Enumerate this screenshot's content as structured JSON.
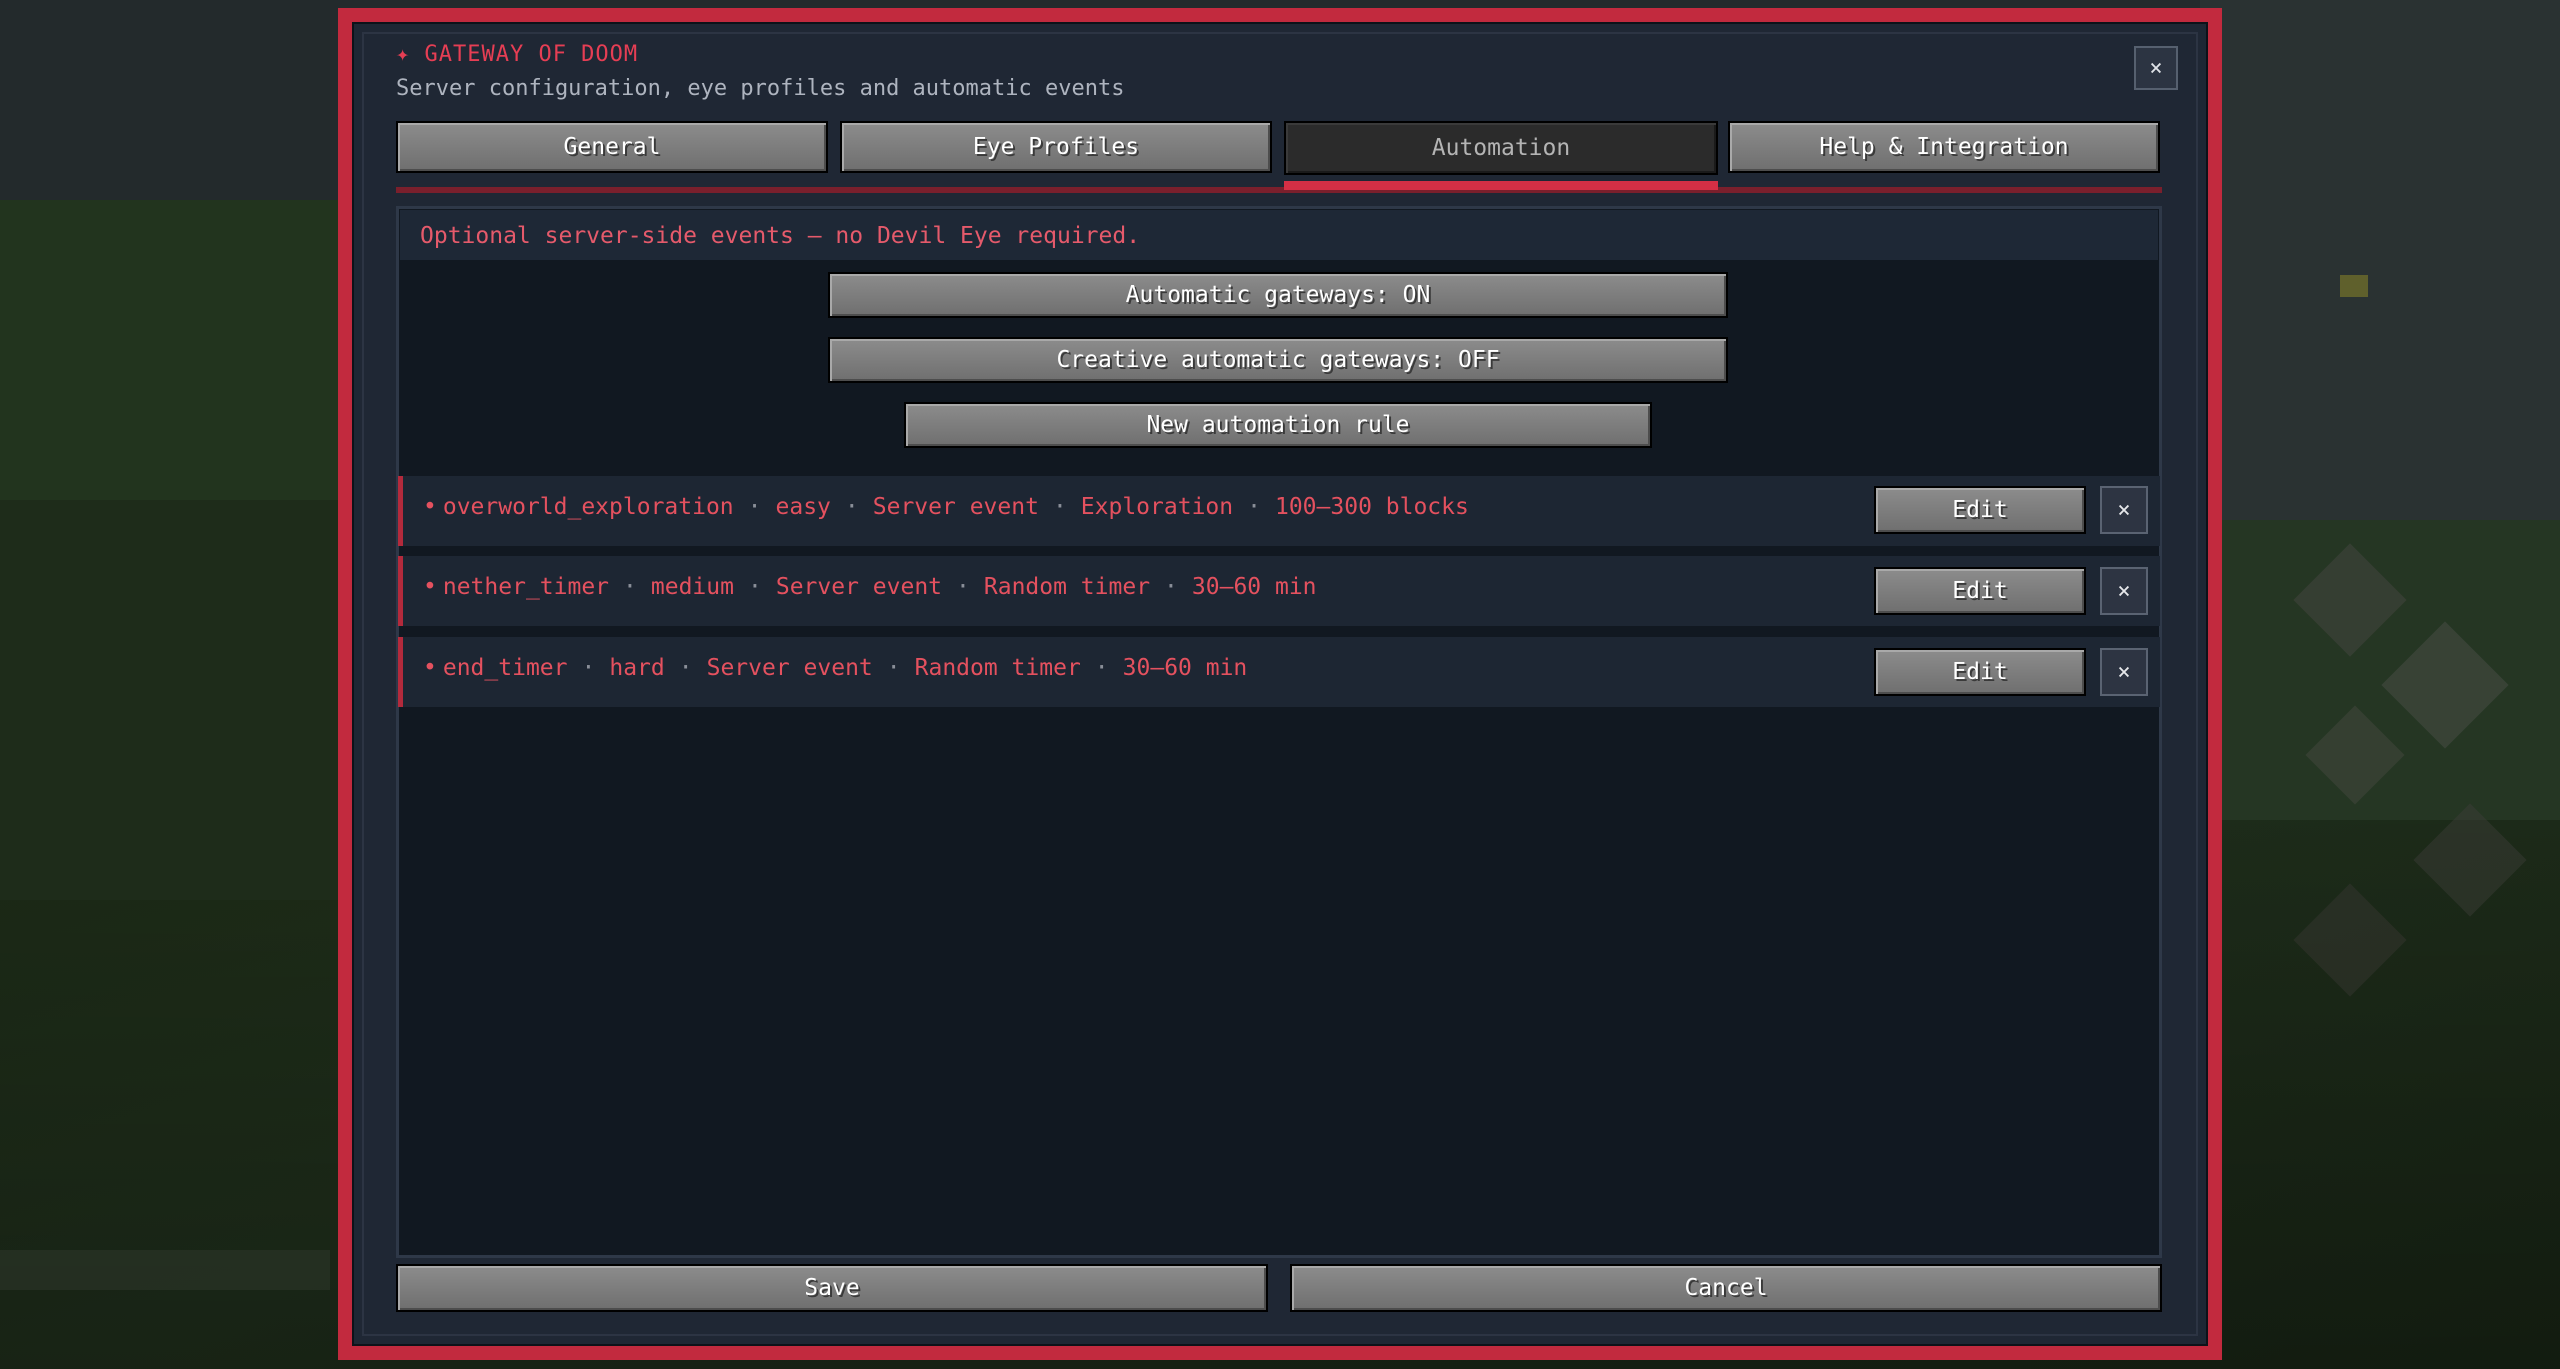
{
  "dialog": {
    "title": "✦ GATEWAY OF DOOM",
    "subtitle": "Server configuration, eye profiles and automatic events",
    "close_label": "×"
  },
  "tabs": [
    {
      "label": "General",
      "active": false
    },
    {
      "label": "Eye Profiles",
      "active": false
    },
    {
      "label": "Automation",
      "active": true
    },
    {
      "label": "Help & Integration",
      "active": false
    }
  ],
  "automation": {
    "header": "Optional server-side events — no Devil Eye required.",
    "automatic_gateways_label": "Automatic gateways: ON",
    "creative_gateways_label": "Creative automatic gateways: OFF",
    "new_rule_label": "New automation rule",
    "rules": [
      {
        "name": "overworld_exploration",
        "difficulty": "easy",
        "source": "Server event",
        "trigger": "Exploration",
        "range": "100–300 blocks",
        "edit_label": "Edit",
        "delete_label": "×"
      },
      {
        "name": "nether_timer",
        "difficulty": "medium",
        "source": "Server event",
        "trigger": "Random timer",
        "range": "30–60 min",
        "edit_label": "Edit",
        "delete_label": "×"
      },
      {
        "name": "end_timer",
        "difficulty": "hard",
        "source": "Server event",
        "trigger": "Random timer",
        "range": "30–60 min",
        "edit_label": "Edit",
        "delete_label": "×"
      }
    ]
  },
  "footer": {
    "save_label": "Save",
    "cancel_label": "Cancel"
  },
  "colors": {
    "accent": "#c22a3e",
    "rule_text": "#e4515f",
    "panel_bg": "#111821"
  }
}
